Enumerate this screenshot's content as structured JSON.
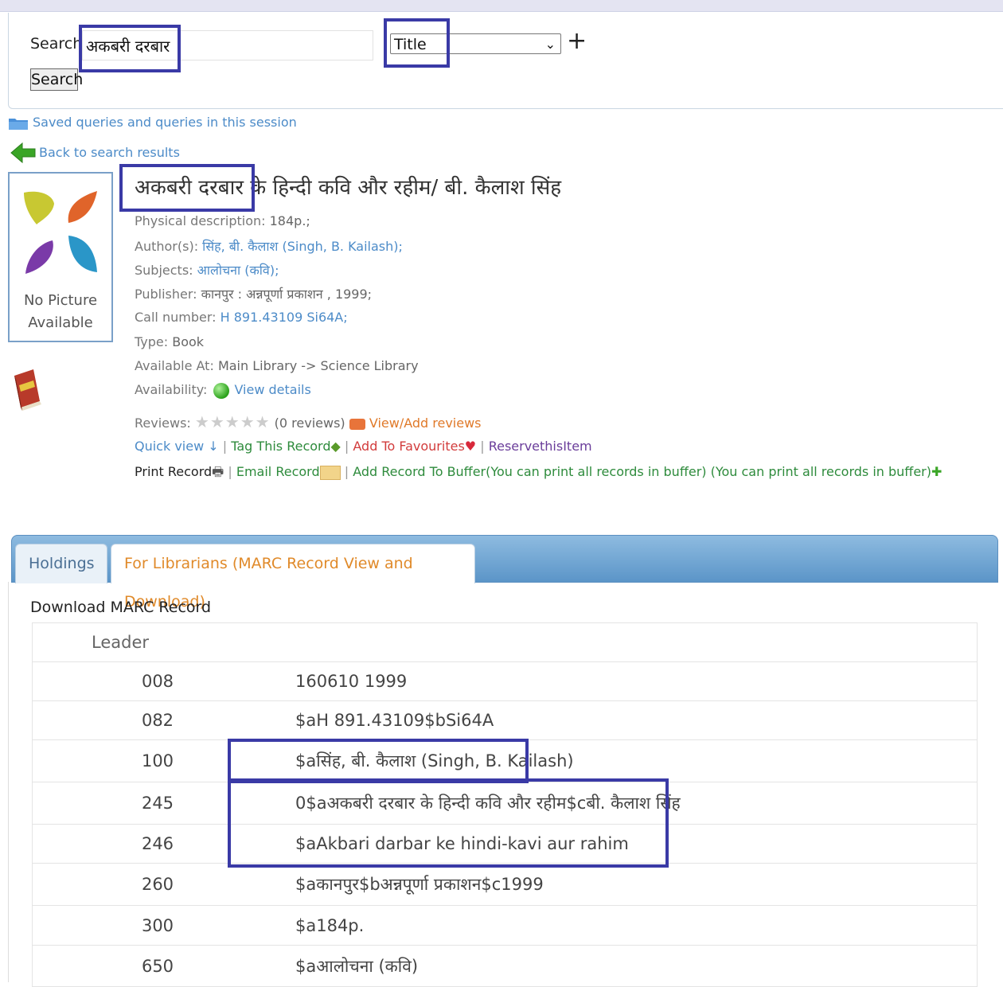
{
  "search": {
    "label": "Search",
    "value": "अकबरी दरबार",
    "field_select": "Title",
    "add_icon": "+",
    "button": "Search"
  },
  "nav": {
    "saved_queries": "Saved queries and queries in this session",
    "back": "Back to search results"
  },
  "cover": {
    "line1": "No Picture",
    "line2": "Available"
  },
  "record": {
    "title": "अकबरी दरबार के हिन्दी कवि और रहीम/ बी. कैलाश सिंह",
    "physical_label": "Physical description:",
    "physical_value": "184p.;",
    "author_label": "Author(s):",
    "author_value": "सिंह, बी. कैलाश (Singh, B. Kailash);",
    "subjects_label": "Subjects:",
    "subjects_value": "आलोचना (कवि);",
    "publisher_label": "Publisher:",
    "publisher_value": "कानपुर : अन्नपूर्णा प्रकाशन , 1999;",
    "call_label": "Call number:",
    "call_value": "H 891.43109 Si64A;",
    "type_label": "Type:",
    "type_value": "Book",
    "available_label": "Available At:",
    "available_value": "Main Library -> Science Library",
    "availability_label": "Availability:",
    "availability_link": "View details",
    "reviews_label": "Reviews:",
    "reviews_count": "(0 reviews)",
    "reviews_link": "View/Add reviews"
  },
  "actions": {
    "quick_view": "Quick view ↓",
    "tag": "Tag This Record",
    "favourites": "Add To Favourites",
    "reserve": "ReservethisItem",
    "print": "Print Record",
    "email": "Email Record",
    "buffer": "Add Record To Buffer(You can print all records in buffer) (You can print all records in buffer)"
  },
  "tabs": [
    "Holdings",
    "For Librarians (MARC Record View and Download)"
  ],
  "marc": {
    "heading": "Download MARC Record",
    "leader": "Leader",
    "rows": [
      {
        "tag": "008",
        "value": "160610 1999"
      },
      {
        "tag": "082",
        "value": "$aH 891.43109$bSi64A"
      },
      {
        "tag": "100",
        "value": "$aसिंह, बी. कैलाश (Singh, B. Kailash)"
      },
      {
        "tag": "245",
        "value": "0$aअकबरी दरबार के हिन्दी कवि और रहीम$cबी. कैलाश सिंह"
      },
      {
        "tag": "246",
        "value": "$aAkbari darbar ke hindi-kavi aur rahim"
      },
      {
        "tag": "260",
        "value": "$aकानपुर$bअन्नपूर्णा प्रकाशन$c1999"
      },
      {
        "tag": "300",
        "value": "$a184p."
      },
      {
        "tag": "650",
        "value": "$aआलोचना (कवि)"
      }
    ]
  },
  "colors": {
    "highlight": "#3a3aa6",
    "link": "#4c8bc8",
    "tab_active_text": "#e08a2a"
  }
}
